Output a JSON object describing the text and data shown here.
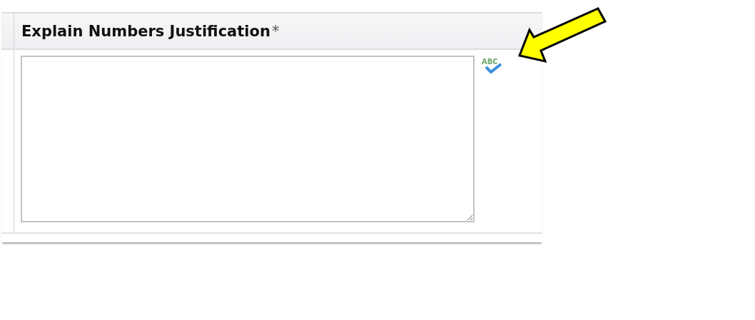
{
  "field": {
    "label": "Explain Numbers Justification",
    "required_mark": "*"
  },
  "spellcheck": {
    "label": "ABC"
  },
  "annotation": {
    "kind": "arrow"
  }
}
